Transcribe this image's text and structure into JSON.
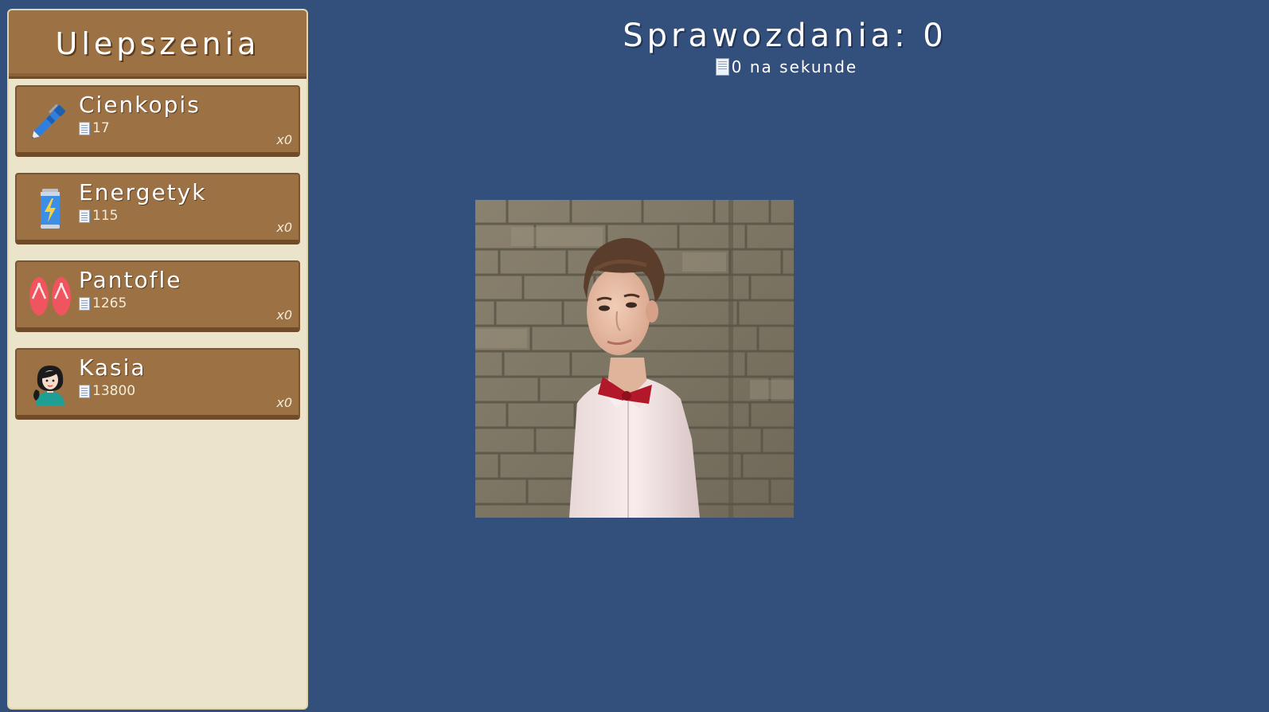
{
  "sidebar": {
    "title": "Ulepszenia",
    "items": [
      {
        "name": "Cienkopis",
        "cost": "17",
        "count": "x0",
        "icon": "pen-icon"
      },
      {
        "name": "Energetyk",
        "cost": "115",
        "count": "x0",
        "icon": "energy-drink-icon"
      },
      {
        "name": "Pantofle",
        "cost": "1265",
        "count": "x0",
        "icon": "flip-flops-icon"
      },
      {
        "name": "Kasia",
        "cost": "13800",
        "count": "x0",
        "icon": "woman-avatar-icon"
      }
    ]
  },
  "score": {
    "label": "Sprawozdania: 0",
    "rate": "0 na sekunde"
  },
  "colors": {
    "background": "#334f7b",
    "panel": "#ece3cb",
    "item": "#9c7144"
  }
}
